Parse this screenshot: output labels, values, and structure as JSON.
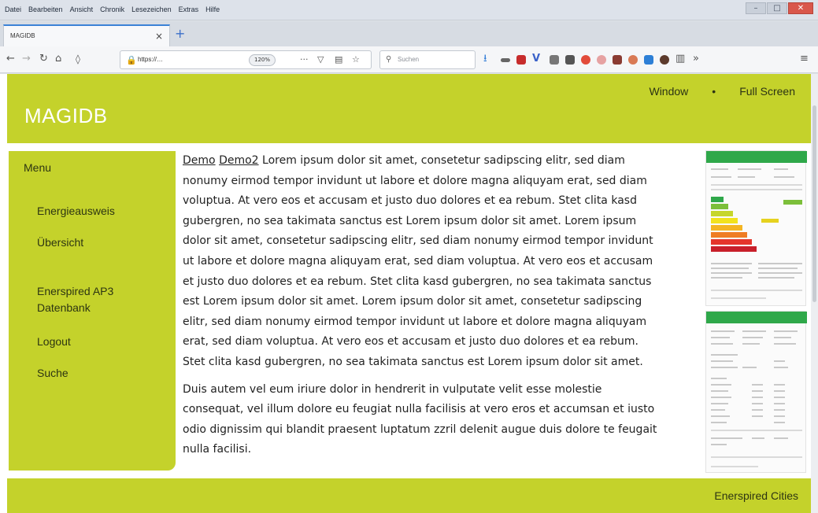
{
  "browser": {
    "menu": [
      "Datei",
      "Bearbeiten",
      "Ansicht",
      "Chronik",
      "Lesezeichen",
      "Extras",
      "Hilfe"
    ],
    "tab_title": "MAGIDB",
    "url": "https://…",
    "zoom": "120%",
    "search_placeholder": "Suchen",
    "icons": [
      "back-icon",
      "forward-icon",
      "reload-icon",
      "home-icon",
      "shield-icon",
      "lock-icon",
      "page-actions-icon",
      "pocket-icon",
      "reader-icon",
      "bookmark-star-icon",
      "download-icon",
      "library-icon",
      "sidebar-icon",
      "overflow-icon",
      "menu-icon"
    ]
  },
  "site": {
    "title": "MAGIDB",
    "nav": [
      "Window",
      "•",
      "Full Screen"
    ],
    "menu_title": "Menu",
    "menu_items": [
      "Energieausweis",
      "Übersicht",
      "Enerspired AP3 Datenbank",
      "Logout",
      "Suche"
    ],
    "content": {
      "link1": "Demo",
      "link2": "Demo2",
      "para1": " Lorem ipsum dolor sit amet, consetetur sadipscing elitr, sed diam nonumy eirmod tempor invidunt ut labore et dolore magna aliquyam erat, sed diam voluptua. At vero eos et accusam et justo duo dolores et ea rebum. Stet clita kasd gubergren, no sea takimata sanctus est Lorem ipsum dolor sit amet. Lorem ipsum dolor sit amet, consetetur sadipscing elitr, sed diam nonumy eirmod tempor invidunt ut labore et dolore magna aliquyam erat, sed diam voluptua. At vero eos et accusam et justo duo dolores et ea rebum. Stet clita kasd gubergren, no sea takimata sanctus est Lorem ipsum dolor sit amet. Lorem ipsum dolor sit amet, consetetur sadipscing elitr, sed diam nonumy eirmod tempor invidunt ut labore et dolore magna aliquyam erat, sed diam voluptua. At vero eos et accusam et justo duo dolores et ea rebum. Stet clita kasd gubergren, no sea takimata sanctus est Lorem ipsum dolor sit amet.",
      "para2": "Duis autem vel eum iriure dolor in hendrerit in vulputate velit esse molestie consequat, vel illum dolore eu feugiat nulla facilisis at vero eros et accumsan et iusto odio dignissim qui blandit praesent luptatum zzril delenit augue duis dolore te feugait nulla facilisi."
    },
    "footer": "Enerspired Cities"
  },
  "colors": {
    "brand": "#c4d22b",
    "tab_accent": "#3b82d6",
    "thumbnail_header": "#2fa84a",
    "energy_scale": [
      "#2fa84a",
      "#7cbf3a",
      "#c6d62c",
      "#f2e21e",
      "#f4b523",
      "#ef7d24",
      "#e5352b",
      "#c81f2a"
    ]
  }
}
